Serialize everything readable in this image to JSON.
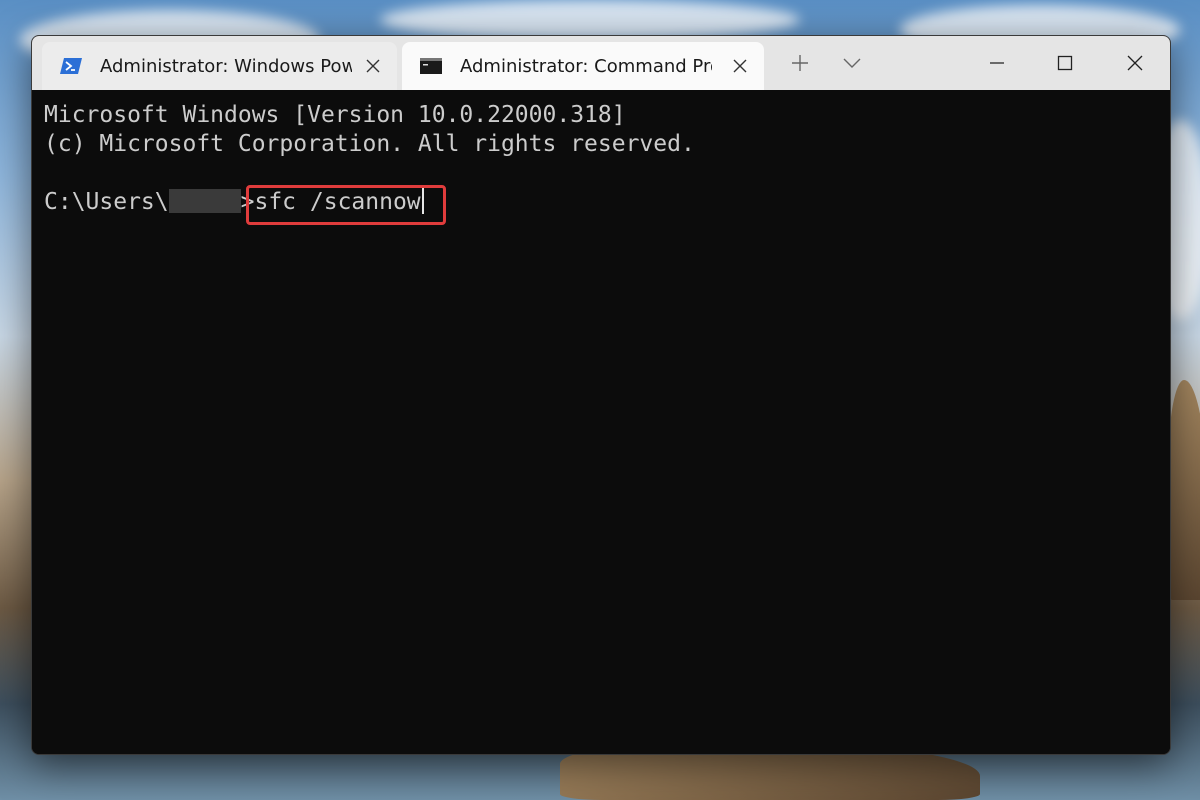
{
  "tabs": [
    {
      "title": "Administrator: Windows PowerShell",
      "active": false,
      "icon": "powershell-icon"
    },
    {
      "title": "Administrator: Command Prompt",
      "active": true,
      "icon": "cmd-icon"
    }
  ],
  "tab_bar": {
    "new_tab_icon": "plus-icon",
    "dropdown_icon": "chevron-down-icon"
  },
  "window_controls": {
    "minimize": "minimize-icon",
    "maximize": "maximize-icon",
    "close": "close-icon"
  },
  "console": {
    "line1": "Microsoft Windows [Version 10.0.22000.318]",
    "line2": "(c) Microsoft Corporation. All rights reserved.",
    "prompt_prefix": "C:\\Users\\",
    "prompt_suffix": ">",
    "command": "sfc /scannow"
  },
  "colors": {
    "console_bg": "#0c0c0c",
    "console_text": "#cccccc",
    "highlight": "#e03c3c",
    "titlebar": "#e5e5e5"
  }
}
